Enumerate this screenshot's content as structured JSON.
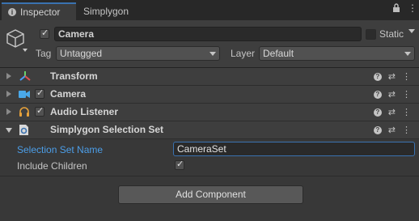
{
  "tabs": [
    {
      "label": "Inspector",
      "active": true,
      "icon": "info-icon"
    },
    {
      "label": "Simplygon",
      "active": false
    }
  ],
  "window_controls": [
    "lock-icon",
    "kebab-menu-icon"
  ],
  "header": {
    "icon": "cube-icon",
    "active": true,
    "name": "Camera",
    "static_label": "Static",
    "static_checked": false,
    "tag_label": "Tag",
    "tag_value": "Untagged",
    "layer_label": "Layer",
    "layer_value": "Default"
  },
  "components": [
    {
      "name": "Transform",
      "icon": "transform-icon",
      "has_checkbox": false,
      "expanded": false
    },
    {
      "name": "Camera",
      "icon": "camera-icon",
      "has_checkbox": true,
      "checked": true,
      "expanded": false
    },
    {
      "name": "Audio Listener",
      "icon": "headphones-icon",
      "has_checkbox": true,
      "checked": true,
      "expanded": false
    },
    {
      "name": "Simplygon Selection Set",
      "icon": "script-icon",
      "has_checkbox": false,
      "expanded": true
    }
  ],
  "selection_set": {
    "name_label": "Selection Set Name",
    "name_value": "CameraSet",
    "include_children_label": "Include Children",
    "include_children": true
  },
  "add_component_label": "Add Component",
  "colors": {
    "accent_blue": "#3a72b0",
    "highlight_label": "#4c9ee8",
    "panel_bg": "#383838"
  }
}
